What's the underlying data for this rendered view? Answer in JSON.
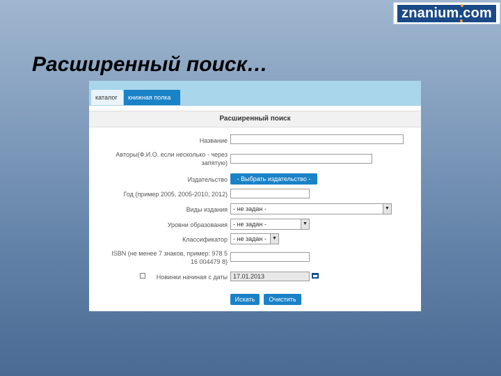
{
  "logo": {
    "text": "znanium.com"
  },
  "slide_title": "Расширенный поиск…",
  "tabs": [
    {
      "label": "каталог"
    },
    {
      "label": "книжная полка"
    }
  ],
  "form": {
    "title": "Расширенный поиск",
    "fields": {
      "name": {
        "label": "Название",
        "value": ""
      },
      "authors": {
        "label_line1": "Авторы(Ф.И.О. если несколько - через",
        "label_line2": "запятую)",
        "value": ""
      },
      "publisher": {
        "label": "Издательство",
        "button": "- Выбрать издательство -"
      },
      "year": {
        "label": "Год (пример 2005, 2005-2010, 2012)",
        "value": ""
      },
      "edition_types": {
        "label": "Виды издания",
        "selected": "- не задан -"
      },
      "education_level": {
        "label": "Уровни образования",
        "selected": "- не задан -"
      },
      "classifier": {
        "label": "Классификатор",
        "selected": "- не задан -"
      },
      "isbn": {
        "label_line1": "ISBN (не менее 7 знаков, пример: 978 5",
        "label_line2": "16 004479 8)",
        "value": ""
      },
      "new_since": {
        "label": "Новинки начиная с даты",
        "value": "17.01.2013",
        "checked": false
      }
    },
    "buttons": {
      "search": "Искать",
      "clear": "Очистить"
    }
  }
}
